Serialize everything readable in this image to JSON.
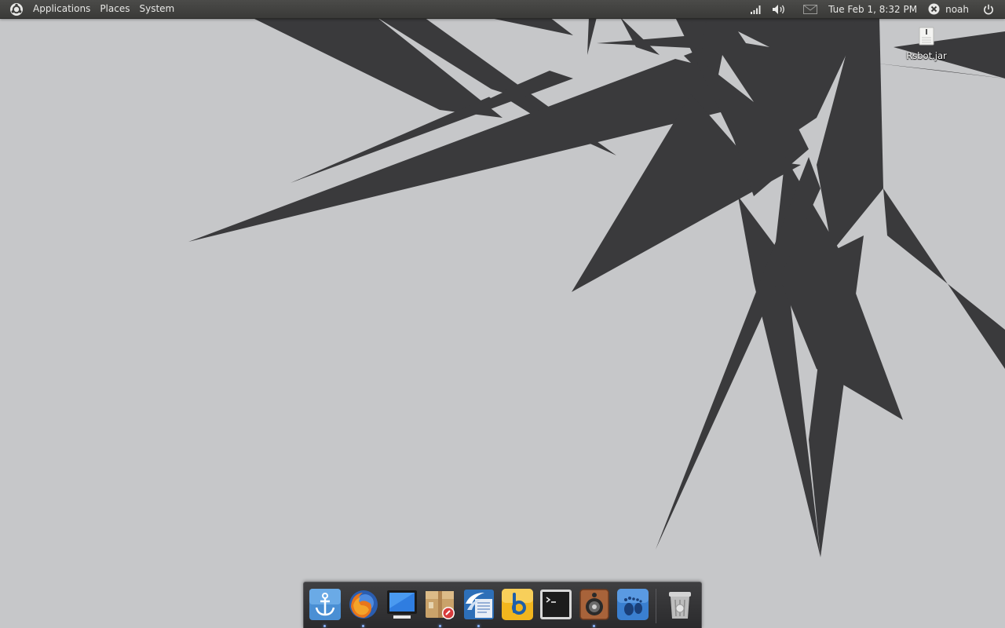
{
  "top_panel": {
    "menus": {
      "applications": "Applications",
      "places": "Places",
      "system": "System"
    },
    "indicators": [
      "network-signal-icon",
      "volume-icon",
      "mail-icon"
    ],
    "clock": "Tue Feb  1,  8:32 PM",
    "user": "noah"
  },
  "desktop": {
    "icons": [
      {
        "label": "Rsbot.jar",
        "icon": "jar-file-icon"
      }
    ]
  },
  "dock": {
    "items": [
      {
        "icon": "docky-anchor-icon",
        "running": true
      },
      {
        "icon": "firefox-icon",
        "running": true
      },
      {
        "icon": "monitor-icon",
        "running": false
      },
      {
        "icon": "package-installer-icon",
        "running": true
      },
      {
        "icon": "openoffice-writer-icon",
        "running": true
      },
      {
        "icon": "banshee-icon",
        "running": false
      },
      {
        "icon": "terminal-icon",
        "running": false
      },
      {
        "icon": "speaker-icon",
        "running": true
      },
      {
        "icon": "gnome-foot-icon",
        "running": false
      }
    ],
    "trash": {
      "icon": "trash-icon"
    }
  },
  "colors": {
    "desktop_background": "#c6c7c9",
    "wallpaper_shapes": "#3a3a3c",
    "panel": "#3f3f3d",
    "dock": "#2f2f31"
  }
}
